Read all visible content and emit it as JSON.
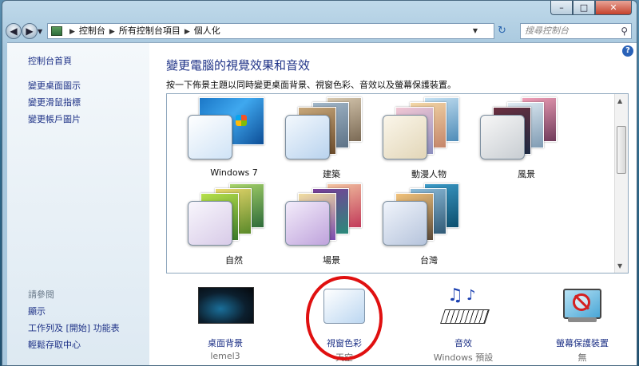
{
  "window": {
    "buttons": {
      "minimize": "–",
      "maximize": "□",
      "close": "✕"
    }
  },
  "nav": {
    "back_icon": "arrow-left-icon",
    "forward_icon": "arrow-right-icon",
    "breadcrumb": [
      "控制台",
      "所有控制台項目",
      "個人化"
    ],
    "search_placeholder": "搜尋控制台"
  },
  "sidebar": {
    "home": "控制台首頁",
    "links": [
      "變更桌面圖示",
      "變更滑鼠指標",
      "變更帳戶圖片"
    ],
    "see_also_header": "請參閱",
    "see_also": [
      "顯示",
      "工作列及 [開始] 功能表",
      "輕鬆存取中心"
    ]
  },
  "main": {
    "title": "變更電腦的視覺效果和音效",
    "description": "按一下佈景主題以同時變更桌面背景、視窗色彩、音效以及螢幕保護裝置。",
    "themes": [
      {
        "name": "Windows 7"
      },
      {
        "name": "建築"
      },
      {
        "name": "動漫人物"
      },
      {
        "name": "風景"
      },
      {
        "name": "自然"
      },
      {
        "name": "場景"
      },
      {
        "name": "台灣"
      }
    ],
    "bottom": [
      {
        "label": "桌面背景",
        "value": "lemel3",
        "icon": "desktop-background-icon"
      },
      {
        "label": "視窗色彩",
        "value": "天空",
        "icon": "window-color-icon"
      },
      {
        "label": "音效",
        "value": "Windows 預設",
        "icon": "sound-icon"
      },
      {
        "label": "螢幕保護裝置",
        "value": "無",
        "icon": "screensaver-icon"
      }
    ]
  },
  "colors": {
    "link": "#1e3287",
    "highlight_ring": "#e01010"
  }
}
